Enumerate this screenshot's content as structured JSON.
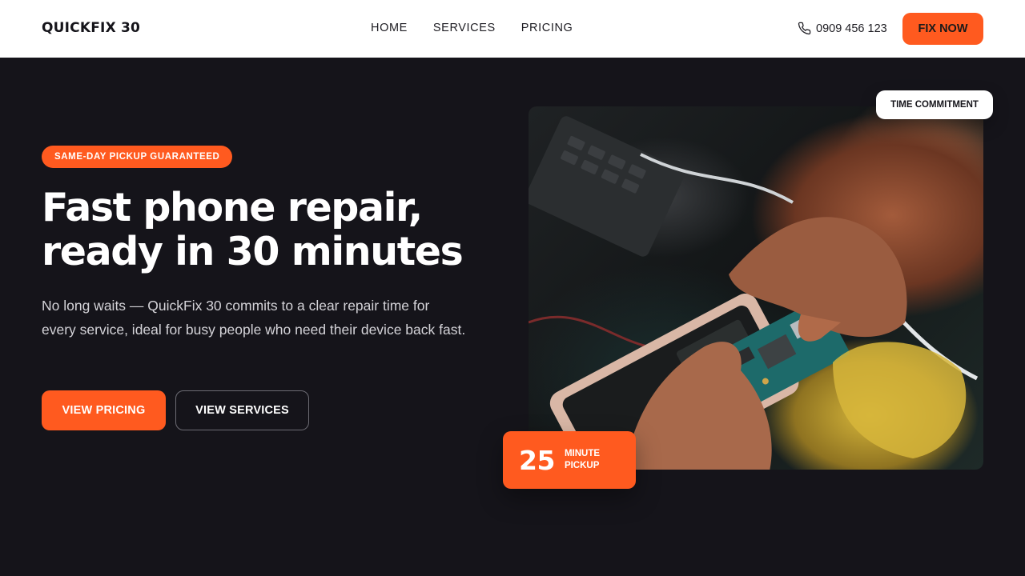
{
  "header": {
    "logo": "QUICKFIX 30",
    "nav": [
      "HOME",
      "SERVICES",
      "PRICING"
    ],
    "phone": "0909 456 123",
    "cta": "FIX NOW"
  },
  "hero": {
    "badge": "SAME-DAY PICKUP GUARANTEED",
    "headline_line1": "Fast phone repair,",
    "headline_line2": "ready in 30 minutes",
    "description": "No long waits — QuickFix 30 commits to a clear repair time for every service, ideal for busy people who need their device back fast.",
    "primary_button": "VIEW PRICING",
    "secondary_button": "VIEW SERVICES"
  },
  "image_panel": {
    "tag": "TIME COMMITMENT",
    "stat_number": "25",
    "stat_label_line1": "MINUTE",
    "stat_label_line2": "PICKUP"
  },
  "colors": {
    "accent": "#ff5a1f",
    "background": "#15141a",
    "header_bg": "#ffffff"
  },
  "icons": {
    "phone": "phone-icon"
  }
}
